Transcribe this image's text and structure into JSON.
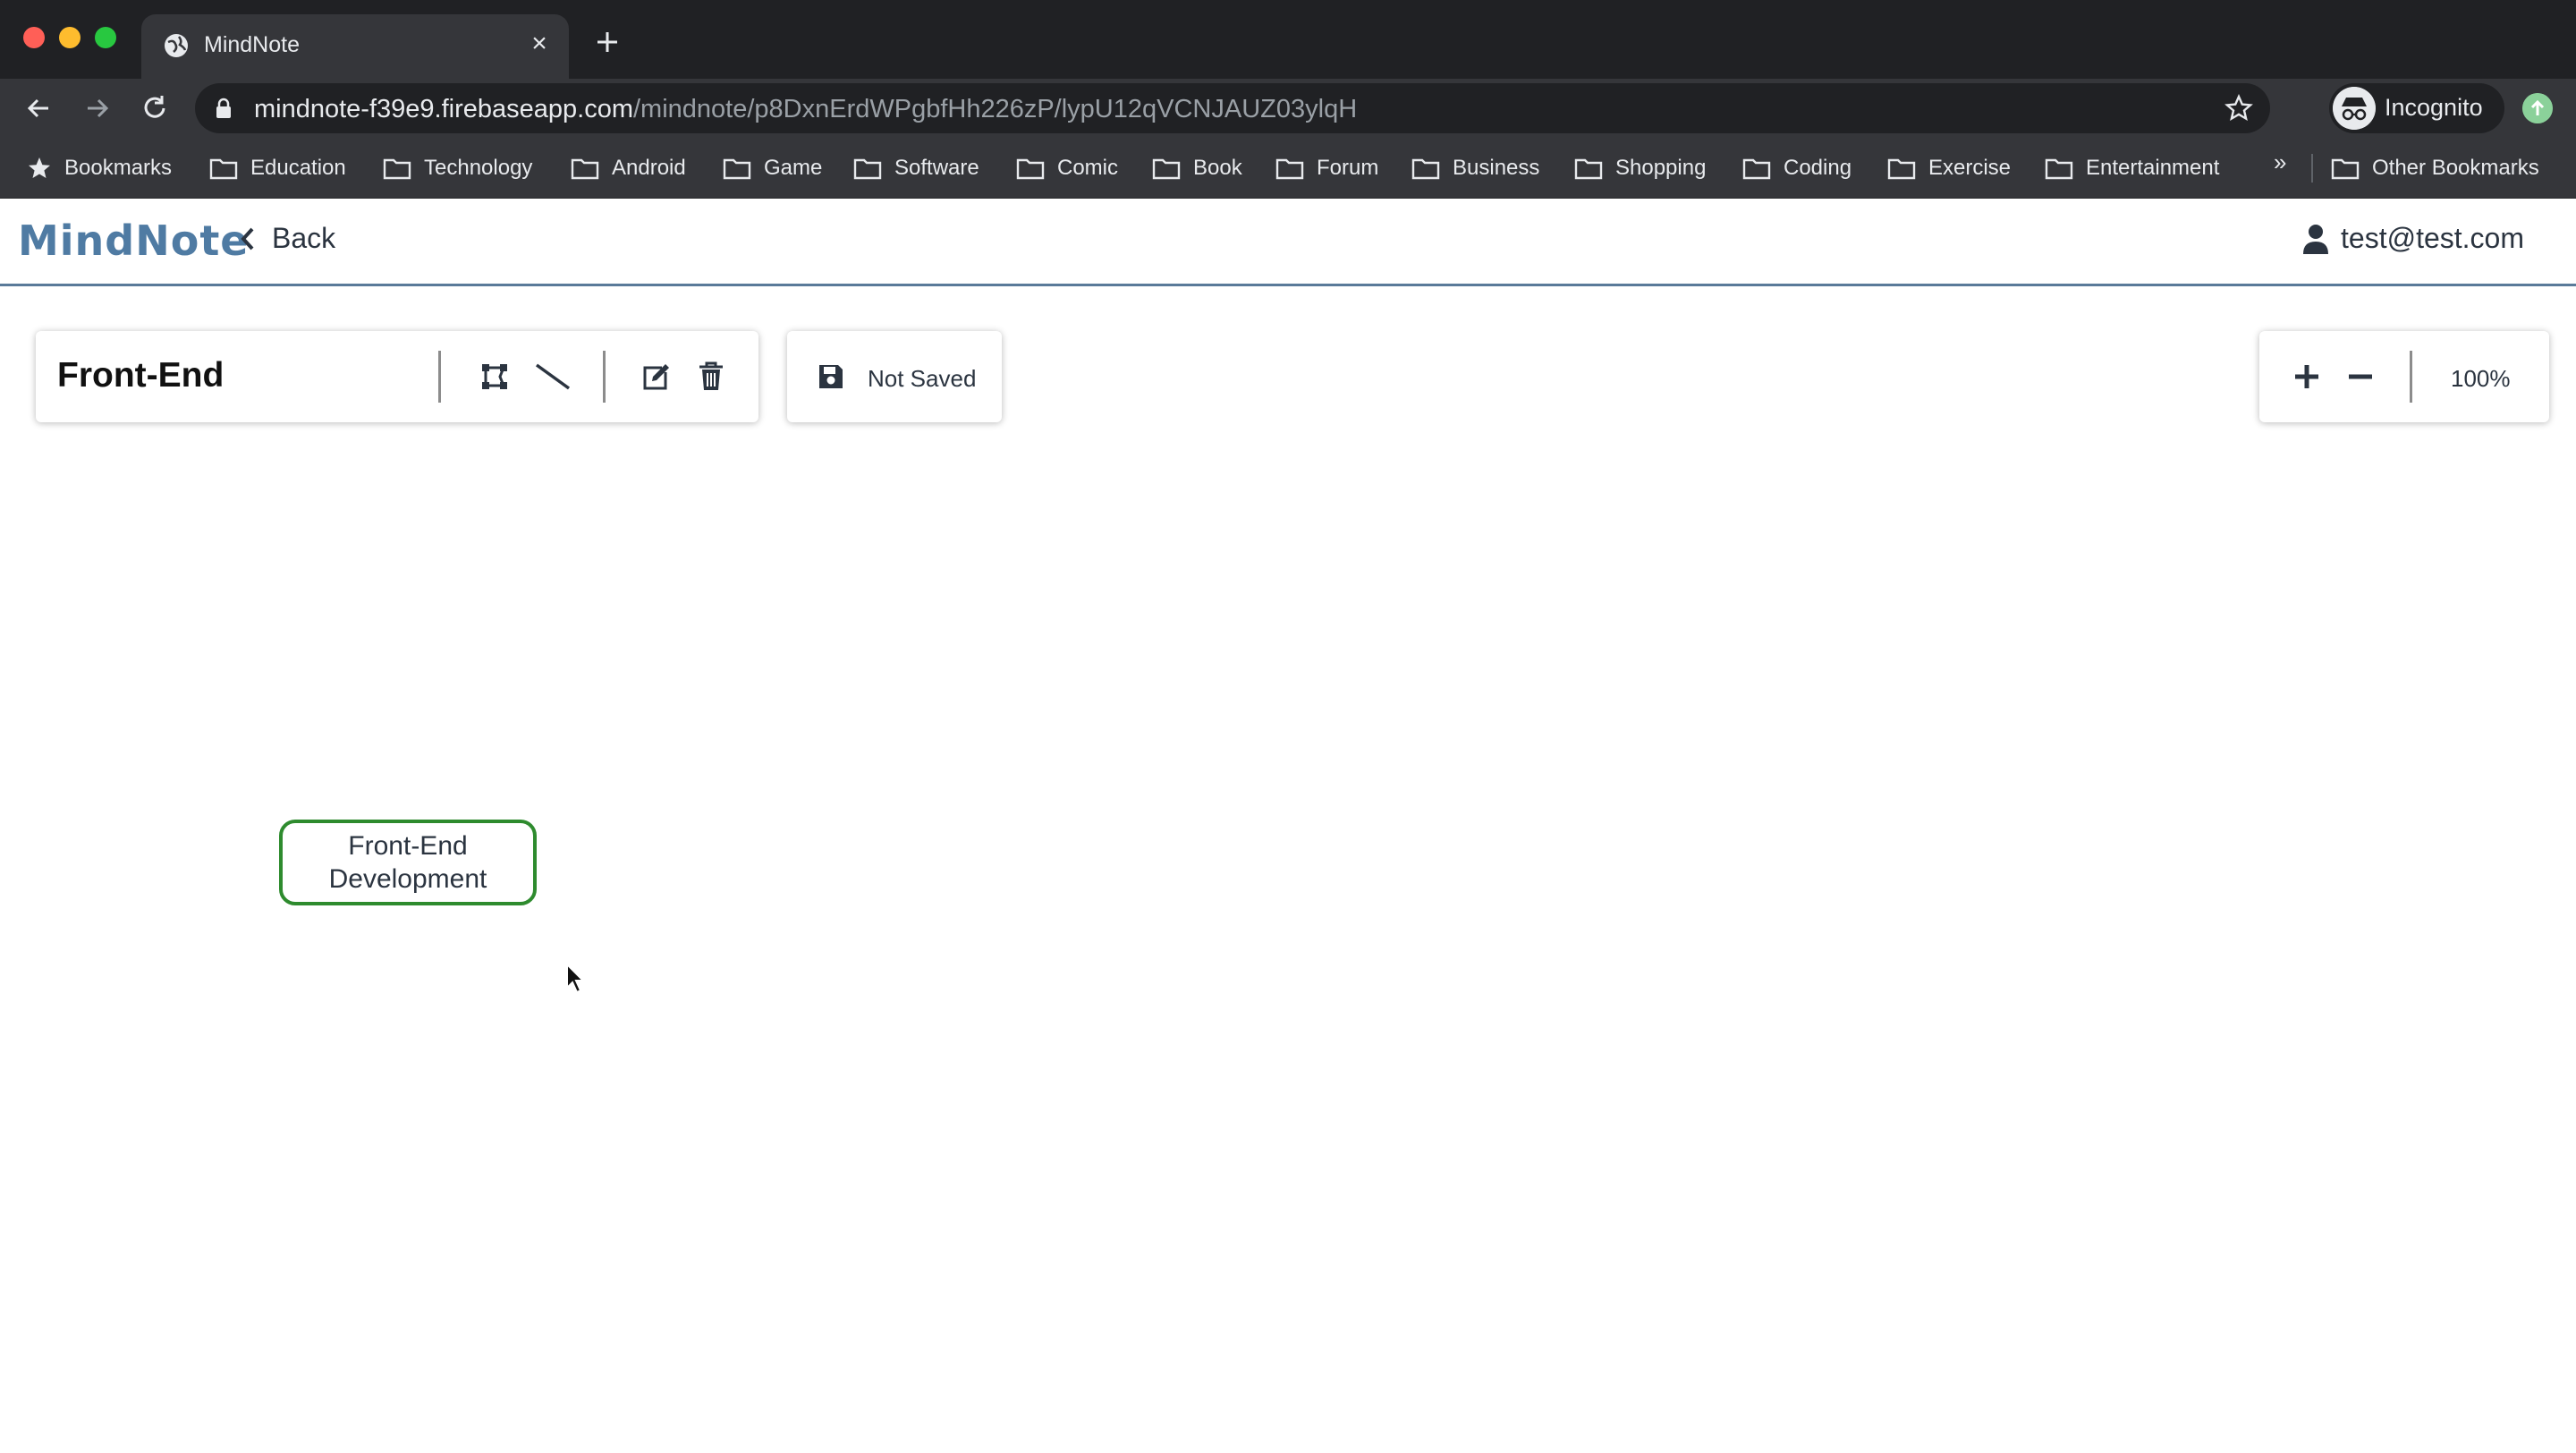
{
  "browser": {
    "tab_title": "MindNote",
    "url_host": "mindnote-f39e9.firebaseapp.com",
    "url_path": "/mindnote/p8DxnErdWPgbfHh226zP/lypU12qVCNJAUZ03ylqH",
    "incognito_label": "Incognito",
    "bookmarks": [
      "Bookmarks",
      "Education",
      "Technology",
      "Android",
      "Game",
      "Software",
      "Comic",
      "Book",
      "Forum",
      "Business",
      "Shopping",
      "Coding",
      "Exercise",
      "Entertainment"
    ],
    "bookmarks_more": "»",
    "other_bookmarks": "Other Bookmarks"
  },
  "app": {
    "logo": "MindNote",
    "back_label": "Back",
    "user_email": "test@test.com"
  },
  "toolbar": {
    "map_title": "Front-End",
    "save_status": "Not Saved",
    "zoom_level": "100%"
  },
  "canvas": {
    "nodes": [
      {
        "text": "Front-End Development"
      }
    ]
  },
  "colors": {
    "brand": "#4f7ba3",
    "node_border": "#2e8b2e",
    "header_rule": "#5a7a99"
  },
  "icons": [
    "globe-icon",
    "close-icon",
    "plus-icon",
    "back-arrow-icon",
    "forward-arrow-icon",
    "reload-icon",
    "lock-icon",
    "star-icon",
    "incognito-icon",
    "update-icon",
    "folder-icon",
    "chevron-left-icon",
    "user-icon",
    "add-node-icon",
    "connect-line-icon",
    "edit-icon",
    "trash-icon",
    "save-icon",
    "zoom-in-icon",
    "zoom-out-icon",
    "mouse-cursor-icon"
  ]
}
